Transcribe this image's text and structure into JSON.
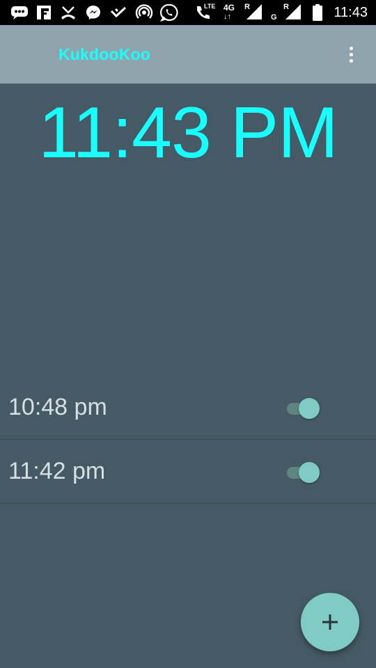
{
  "status_bar": {
    "time": "11:43",
    "lte_label": "LTE",
    "network_label": "4G",
    "roaming_1": "R",
    "roaming_2": "R",
    "sim_2_label": "G",
    "icons": [
      "messaging-icon",
      "flipboard-icon",
      "missed-call-icon",
      "messenger-icon",
      "check-icon",
      "hotspot-icon",
      "whatsapp-icon",
      "call-icon",
      "signal-icon",
      "signal-icon",
      "battery-icon"
    ]
  },
  "app_bar": {
    "title": "KukdooKoo",
    "overflow_icon": "more-vert-icon",
    "title_color": "#18ffff",
    "background": "#90a4ae"
  },
  "clock": {
    "time": "11:43 PM",
    "color": "#18ffff"
  },
  "alarms": [
    {
      "time": "10:48 pm",
      "enabled": true
    },
    {
      "time": "11:42 pm",
      "enabled": true
    }
  ],
  "fab": {
    "icon": "add-icon",
    "color": "#80cbc4"
  },
  "theme": {
    "background": "#455a64",
    "accent": "#80cbc4"
  }
}
